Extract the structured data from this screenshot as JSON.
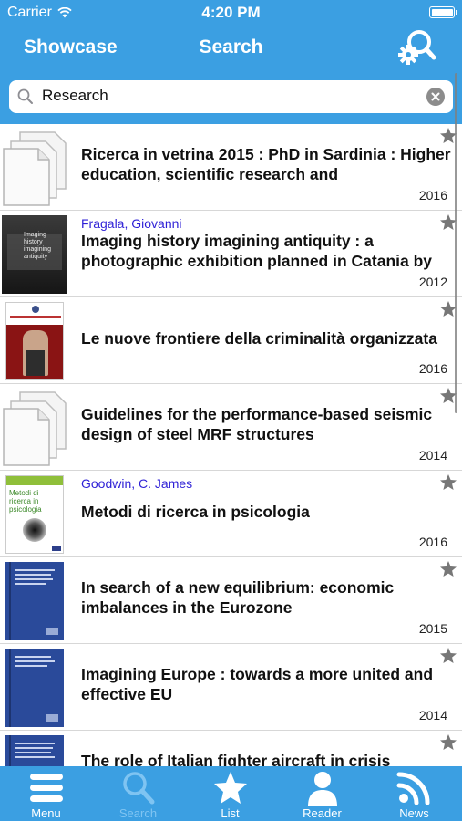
{
  "status_bar": {
    "carrier": "Carrier",
    "time": "4:20 PM"
  },
  "nav": {
    "left": "Showcase",
    "title": "Search",
    "right_icon": "search-settings-icon"
  },
  "search": {
    "value": "Research",
    "placeholder": ""
  },
  "results": [
    {
      "author": "",
      "title": "Ricerca in vetrina 2015 : PhD in Sardinia : Higher education, scientific research and",
      "year": "2016",
      "cover": "placeholder"
    },
    {
      "author": "Fragala, Giovanni",
      "title": "Imaging history imagining antiquity : a photographic exhibition planned in Catania by",
      "year": "2012",
      "cover": "photo-dark",
      "cover_text": "Imaging history imagining antiquity"
    },
    {
      "author": "",
      "title": "Le nuove frontiere della criminalità organizzata",
      "year": "2016",
      "cover": "red"
    },
    {
      "author": "",
      "title": "Guidelines for the performance-based seismic design of steel MRF structures",
      "year": "2014",
      "cover": "placeholder"
    },
    {
      "author": "Goodwin, C. James",
      "title": "Metodi di ricerca in psicologia",
      "year": "2016",
      "cover": "psych",
      "cover_text": "Metodi di ricerca in psicologia"
    },
    {
      "author": "",
      "title": "In search of a new equilibrium: economic imbalances in the Eurozone",
      "year": "2015",
      "cover": "blue"
    },
    {
      "author": "",
      "title": "Imagining Europe : towards a more united and effective EU",
      "year": "2014",
      "cover": "blue"
    },
    {
      "author": "",
      "title": "The role of Italian fighter aircraft in crisis",
      "year": "",
      "cover": "blue"
    }
  ],
  "tabs": [
    {
      "label": "Menu",
      "icon": "menu-icon",
      "active": false
    },
    {
      "label": "Search",
      "icon": "search-icon",
      "active": true
    },
    {
      "label": "List",
      "icon": "star-icon",
      "active": false
    },
    {
      "label": "Reader",
      "icon": "person-icon",
      "active": false
    },
    {
      "label": "News",
      "icon": "rss-icon",
      "active": false
    }
  ],
  "colors": {
    "brand": "#3b9fe2",
    "author_link": "#2d1fd6",
    "tab_active": "#7fc4f2"
  }
}
